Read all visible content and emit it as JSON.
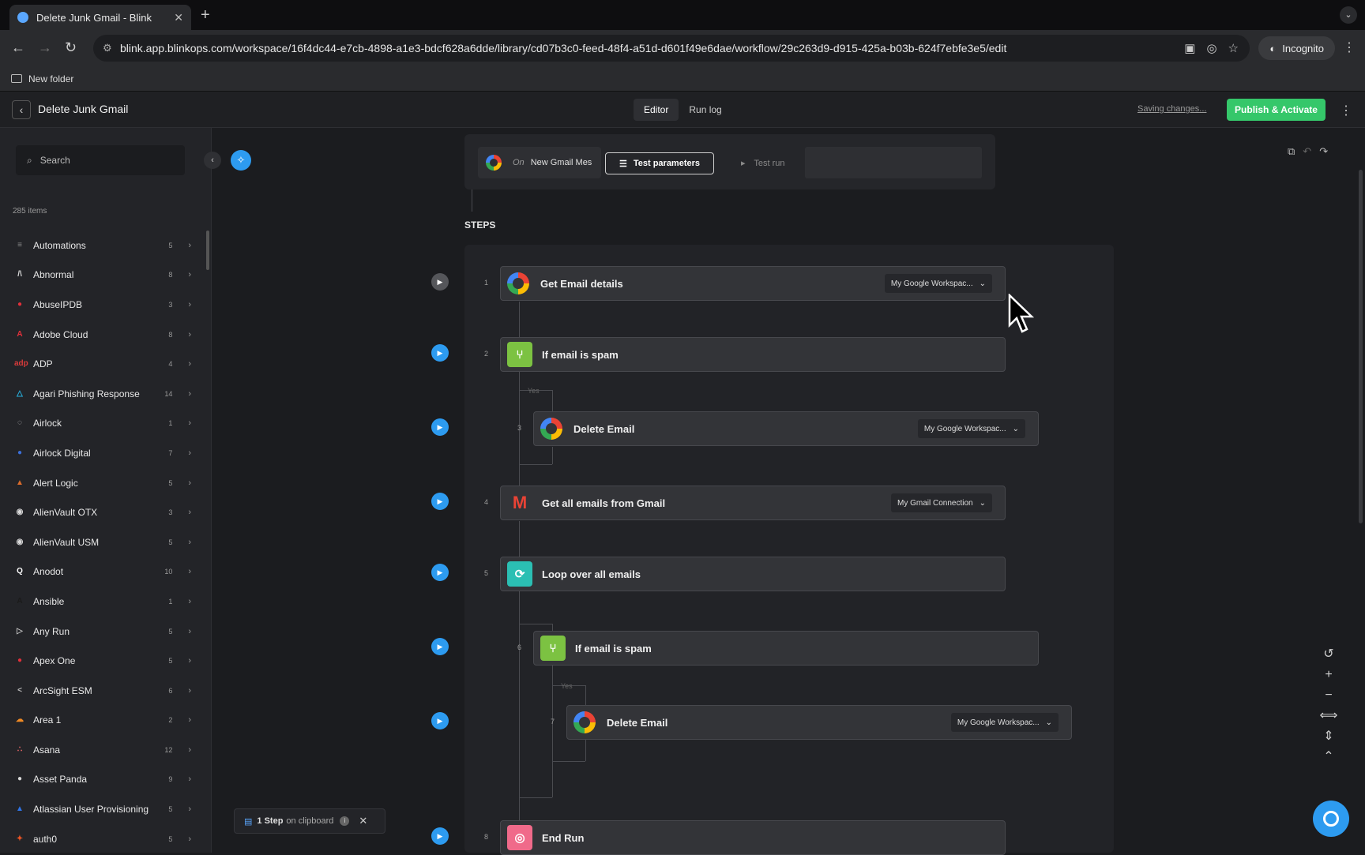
{
  "browser": {
    "tab_title": "Delete Junk Gmail - Blink",
    "url": "blink.app.blinkops.com/workspace/16f4dc44-e7cb-4898-a1e3-bdcf628a6dde/library/cd07b3c0-feed-48f4-a51d-d601f49e6dae/workflow/29c263d9-d915-425a-b03b-624f7ebfe3e5/edit",
    "incognito_label": "Incognito",
    "bookmark": "New folder"
  },
  "app": {
    "workflow_title": "Delete Junk Gmail",
    "modes": [
      "Editor",
      "Run log"
    ],
    "active_mode": "Editor",
    "saving_text": "Saving changes...",
    "publish_label": "Publish & Activate"
  },
  "sidebar": {
    "search_placeholder": "Search",
    "item_count": "285 items",
    "items": [
      {
        "label": "Automations",
        "count": "5",
        "icon_color": "#8a8a8a",
        "glyph": "≡"
      },
      {
        "label": "Abnormal",
        "count": "8",
        "icon_color": "#d9d9d9",
        "glyph": "/\\"
      },
      {
        "label": "AbuseIPDB",
        "count": "3",
        "icon_color": "#e0303a",
        "glyph": "●"
      },
      {
        "label": "Adobe Cloud",
        "count": "8",
        "icon_color": "#e0303a",
        "glyph": "A"
      },
      {
        "label": "ADP",
        "count": "4",
        "icon_color": "#d83b3b",
        "glyph": "adp"
      },
      {
        "label": "Agari Phishing Response",
        "count": "14",
        "icon_color": "#27b4e3",
        "glyph": "△"
      },
      {
        "label": "Airlock",
        "count": "1",
        "icon_color": "#bdbdbd",
        "glyph": "◌"
      },
      {
        "label": "Airlock Digital",
        "count": "7",
        "icon_color": "#3b6fd8",
        "glyph": "●"
      },
      {
        "label": "Alert Logic",
        "count": "5",
        "icon_color": "#d86b2b",
        "glyph": "▲"
      },
      {
        "label": "AlienVault OTX",
        "count": "3",
        "icon_color": "#d9d9d9",
        "glyph": "◉"
      },
      {
        "label": "AlienVault USM",
        "count": "5",
        "icon_color": "#d9d9d9",
        "glyph": "◉"
      },
      {
        "label": "Anodot",
        "count": "10",
        "icon_color": "#ffffff",
        "glyph": "Q"
      },
      {
        "label": "Ansible",
        "count": "1",
        "icon_color": "#1b1b1b",
        "glyph": "A"
      },
      {
        "label": "Any Run",
        "count": "5",
        "icon_color": "#bdbdbd",
        "glyph": "▷"
      },
      {
        "label": "Apex One",
        "count": "5",
        "icon_color": "#e0303a",
        "glyph": "●"
      },
      {
        "label": "ArcSight ESM",
        "count": "6",
        "icon_color": "#bdbdbd",
        "glyph": "<"
      },
      {
        "label": "Area 1",
        "count": "2",
        "icon_color": "#f08a24",
        "glyph": "☁"
      },
      {
        "label": "Asana",
        "count": "12",
        "icon_color": "#f06a6a",
        "glyph": "∴"
      },
      {
        "label": "Asset Panda",
        "count": "9",
        "icon_color": "#d9d9d9",
        "glyph": "●"
      },
      {
        "label": "Atlassian User Provisioning",
        "count": "5",
        "icon_color": "#2f74e6",
        "glyph": "▲"
      },
      {
        "label": "auth0",
        "count": "5",
        "icon_color": "#eb5424",
        "glyph": "✦"
      }
    ]
  },
  "trigger": {
    "prefix": "On",
    "name": "New Gmail Mes",
    "test_params_label": "Test parameters",
    "test_run_label": "Test run"
  },
  "steps_heading": "STEPS",
  "steps": [
    {
      "num": "1",
      "title": "Get Email details",
      "connection": "My Google Workspac...",
      "kind": "google"
    },
    {
      "num": "2",
      "title": "If email is spam",
      "connection": "",
      "kind": "condition"
    },
    {
      "num": "3",
      "title": "Delete Email",
      "connection": "My Google Workspac...",
      "kind": "google"
    },
    {
      "num": "4",
      "title": "Get all emails from Gmail",
      "connection": "My Gmail Connection",
      "kind": "gmail"
    },
    {
      "num": "5",
      "title": "Loop over all emails",
      "connection": "",
      "kind": "loop"
    },
    {
      "num": "6",
      "title": "If email is spam",
      "connection": "",
      "kind": "condition"
    },
    {
      "num": "7",
      "title": "Delete Email",
      "connection": "My Google Workspac...",
      "kind": "google"
    },
    {
      "num": "8",
      "title": "End Run",
      "connection": "",
      "kind": "end"
    }
  ],
  "branch_label": "Yes",
  "clipboard": {
    "count": "1 Step",
    "suffix": "on clipboard"
  },
  "colors": {
    "accent": "#2d9bf0",
    "publish": "#35c76a",
    "condition": "#7cc242",
    "loop": "#2bbfb3",
    "end": "#f06a8a"
  }
}
